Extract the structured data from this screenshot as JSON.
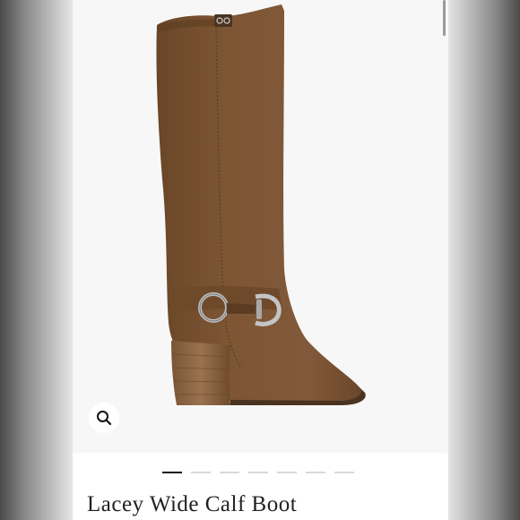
{
  "product": {
    "title": "Lacey Wide Calf Boot",
    "image_description_icon": "boot-image",
    "brand_tag": "CB"
  },
  "gallery": {
    "dot_count": 7,
    "active_index": 0
  },
  "icons": {
    "zoom": "magnifier-icon"
  },
  "colors": {
    "suede": "#7b5533",
    "heel": "#8a6443",
    "hardware": "#b9b9b9",
    "active_dot": "#111111",
    "inactive_dot": "#d9d9d9"
  }
}
